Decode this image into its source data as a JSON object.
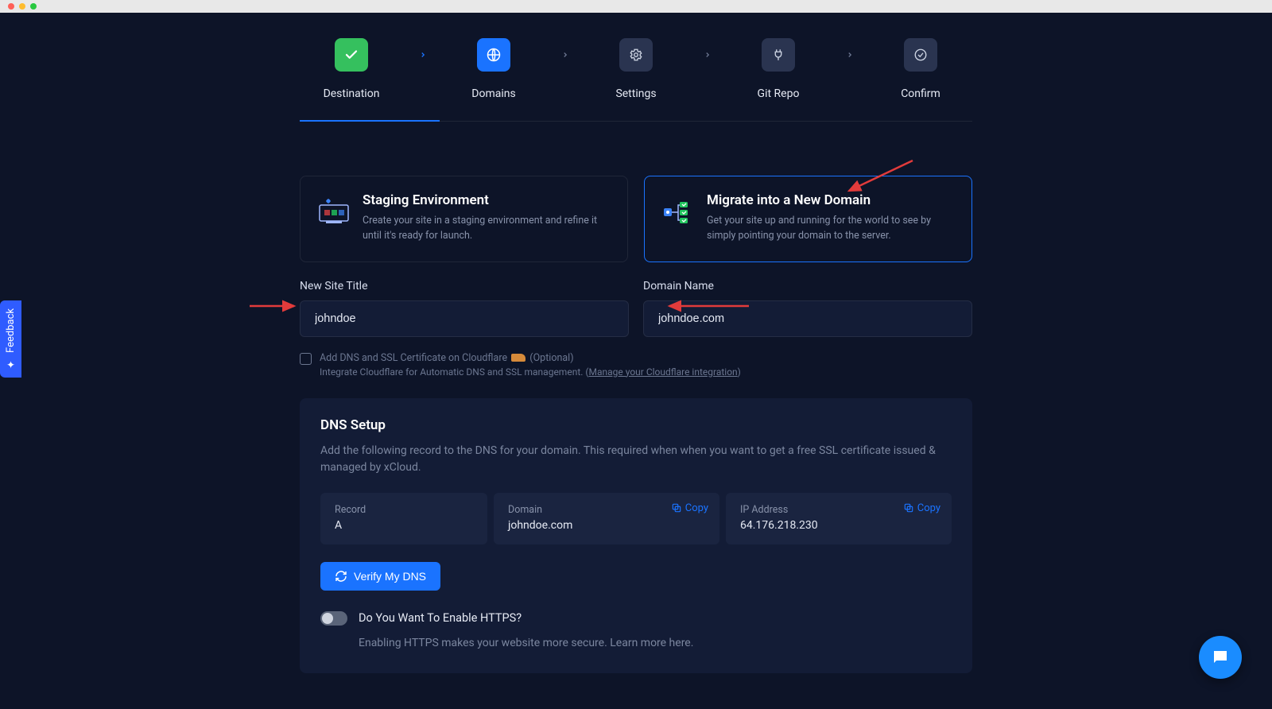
{
  "stepper": {
    "steps": [
      {
        "label": "Destination"
      },
      {
        "label": "Domains"
      },
      {
        "label": "Settings"
      },
      {
        "label": "Git Repo"
      },
      {
        "label": "Confirm"
      }
    ]
  },
  "options": {
    "staging": {
      "title": "Staging Environment",
      "desc": "Create your site in a staging environment and refine it until it's ready for launch."
    },
    "migrate": {
      "title": "Migrate into a New Domain",
      "desc": "Get your site up and running for the world to see by simply pointing your domain to the server."
    }
  },
  "fields": {
    "site_title": {
      "label": "New Site Title",
      "value": "johndoe"
    },
    "domain_name": {
      "label": "Domain Name",
      "value": "johndoe.com"
    }
  },
  "cloudflare": {
    "label": "Add DNS and SSL Certificate on Cloudflare",
    "optional": "(Optional)",
    "sub_prefix": "Integrate Cloudflare for Automatic DNS and SSL management. (",
    "link": "Manage your Cloudflare integration",
    "sub_suffix": ")"
  },
  "dns": {
    "heading": "DNS Setup",
    "desc": "Add the following record to the DNS for your domain. This required when when you want to get a free SSL certificate issued & managed by xCloud.",
    "record_label": "Record",
    "record_value": "A",
    "domain_label": "Domain",
    "domain_value": "johndoe.com",
    "ip_label": "IP Address",
    "ip_value": "64.176.218.230",
    "copy_label": "Copy",
    "verify_label": "Verify My DNS"
  },
  "https": {
    "question": "Do You Want To Enable HTTPS?",
    "sub": "Enabling HTTPS makes your website more secure. Learn more here."
  },
  "ui": {
    "feedback": "Feedback"
  }
}
